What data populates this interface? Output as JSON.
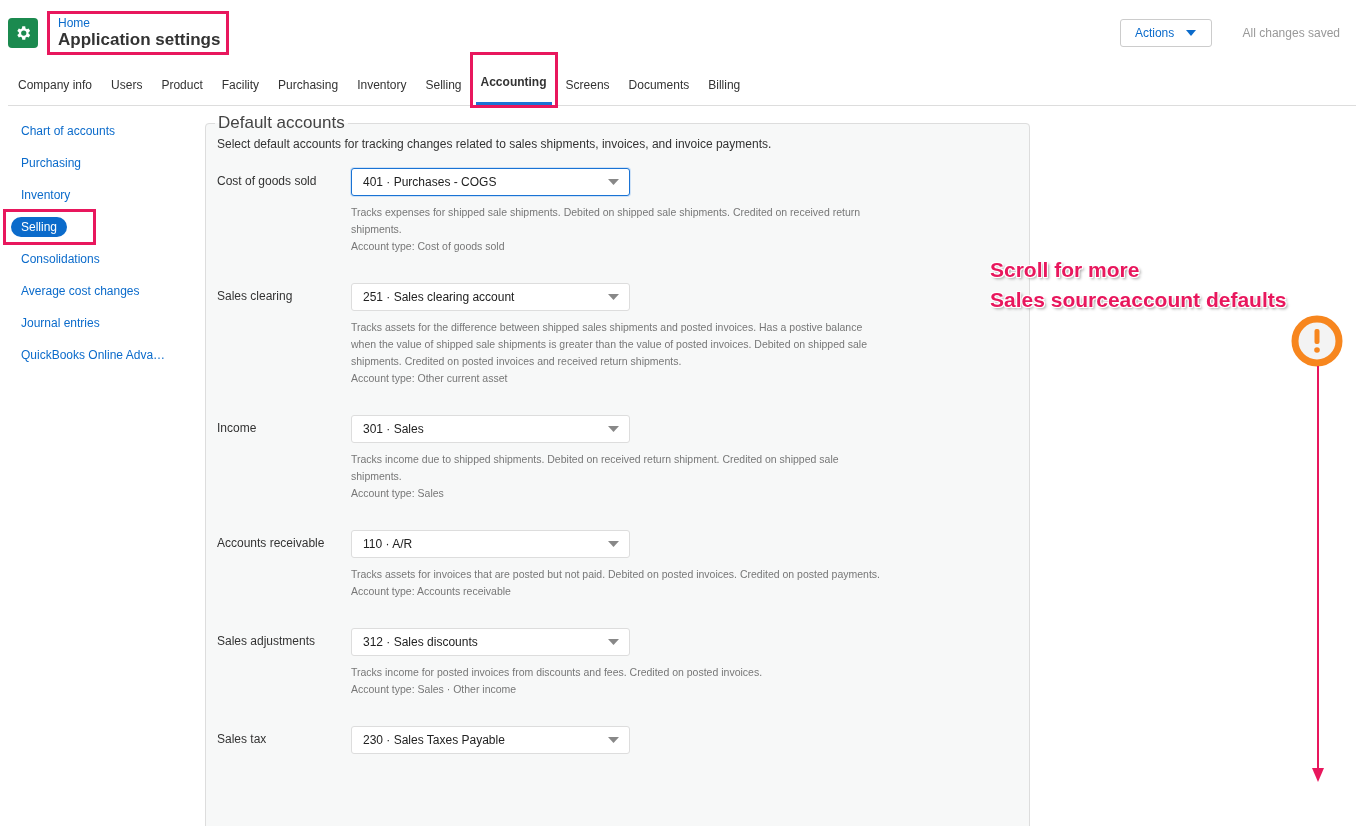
{
  "header": {
    "breadcrumb": "Home",
    "title": "Application settings",
    "highlighted": true,
    "actions_button": "Actions",
    "save_status": "All changes saved"
  },
  "tabs": [
    {
      "label": "Company info",
      "selected": false,
      "highlighted": false
    },
    {
      "label": "Users",
      "selected": false,
      "highlighted": false
    },
    {
      "label": "Product",
      "selected": false,
      "highlighted": false
    },
    {
      "label": "Facility",
      "selected": false,
      "highlighted": false
    },
    {
      "label": "Purchasing",
      "selected": false,
      "highlighted": false
    },
    {
      "label": "Inventory",
      "selected": false,
      "highlighted": false
    },
    {
      "label": "Selling",
      "selected": false,
      "highlighted": false
    },
    {
      "label": "Accounting",
      "selected": true,
      "highlighted": true
    },
    {
      "label": "Screens",
      "selected": false,
      "highlighted": false
    },
    {
      "label": "Documents",
      "selected": false,
      "highlighted": false
    },
    {
      "label": "Billing",
      "selected": false,
      "highlighted": false
    }
  ],
  "sidebar": {
    "items": [
      {
        "label": "Chart of accounts",
        "selected": false,
        "highlighted": false
      },
      {
        "label": "Purchasing",
        "selected": false,
        "highlighted": false
      },
      {
        "label": "Inventory",
        "selected": false,
        "highlighted": false
      },
      {
        "label": "Selling",
        "selected": true,
        "highlighted": true
      },
      {
        "label": "Consolidations",
        "selected": false,
        "highlighted": false
      },
      {
        "label": "Average cost changes",
        "selected": false,
        "highlighted": false
      },
      {
        "label": "Journal entries",
        "selected": false,
        "highlighted": false
      },
      {
        "label": "QuickBooks Online Adva…",
        "selected": false,
        "highlighted": false
      }
    ]
  },
  "section": {
    "title": "Default accounts",
    "intro": "Select default accounts for tracking changes related to sales shipments, invoices, and invoice payments.",
    "fields": [
      {
        "label": "Cost of goods sold",
        "value": "401 · Purchases - COGS",
        "focused": true,
        "description": "Tracks expenses for shipped sale shipments. Debited on shipped sale shipments. Credited on received return shipments.",
        "account_type": "Account type: Cost of goods sold"
      },
      {
        "label": "Sales clearing",
        "value": "251 · Sales clearing account",
        "focused": false,
        "description": "Tracks assets for the difference between shipped sales shipments and posted invoices. Has a postive balance when the value of shipped sale shipments is greater than the value of posted invoices. Debited on shipped sale shipments. Credited on posted invoices and received return shipments.",
        "account_type": "Account type: Other current asset"
      },
      {
        "label": "Income",
        "value": "301 · Sales",
        "focused": false,
        "description": "Tracks income due to shipped shipments. Debited on received return shipment. Credited on shipped sale shipments.",
        "account_type": "Account type: Sales"
      },
      {
        "label": "Accounts receivable",
        "value": "110 · A/R",
        "focused": false,
        "description": "Tracks assets for invoices that are posted but not paid. Debited on posted invoices. Credited on posted payments.",
        "account_type": "Account type: Accounts receivable"
      },
      {
        "label": "Sales adjustments",
        "value": "312 · Sales discounts",
        "focused": false,
        "description": "Tracks income for posted invoices from discounts and fees. Credited on posted invoices.",
        "account_type": "Account type: Sales · Other income"
      },
      {
        "label": "Sales tax",
        "value": "230 · Sales Taxes Payable",
        "focused": false
      }
    ]
  },
  "annotation": {
    "lines": [
      "Scroll for more",
      "Sales sourceaccount defaults"
    ]
  }
}
